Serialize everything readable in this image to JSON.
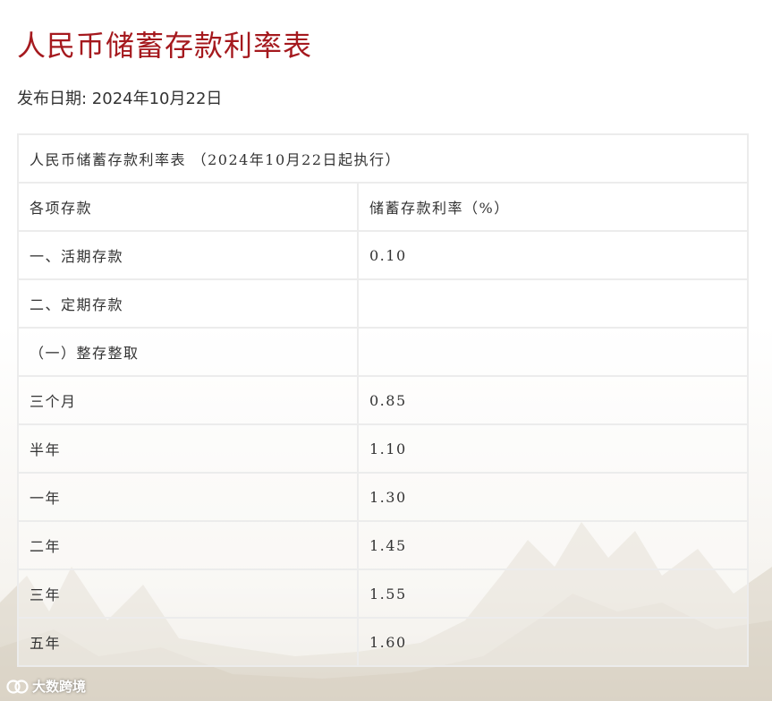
{
  "page": {
    "title": "人民币储蓄存款利率表",
    "publish_label": "发布日期: ",
    "publish_date": "2024年10月22日"
  },
  "table": {
    "caption": "人民币储蓄存款利率表 （2024年10月22日起执行）",
    "header": {
      "category": "各项存款",
      "rate": "储蓄存款利率（%）"
    },
    "rows": [
      {
        "label": "一、活期存款",
        "rate": "0.10"
      },
      {
        "label": "二、定期存款",
        "rate": ""
      },
      {
        "label": "（一）整存整取",
        "rate": ""
      },
      {
        "label": "三个月",
        "rate": "0.85"
      },
      {
        "label": "半年",
        "rate": "1.10"
      },
      {
        "label": "一年",
        "rate": "1.30"
      },
      {
        "label": "二年",
        "rate": "1.45"
      },
      {
        "label": "三年",
        "rate": "1.55"
      },
      {
        "label": "五年",
        "rate": "1.60"
      }
    ]
  },
  "watermark": {
    "text": "大数跨境"
  },
  "colors": {
    "title_red": "#a5191e",
    "text": "#333333",
    "border": "#ececec"
  }
}
